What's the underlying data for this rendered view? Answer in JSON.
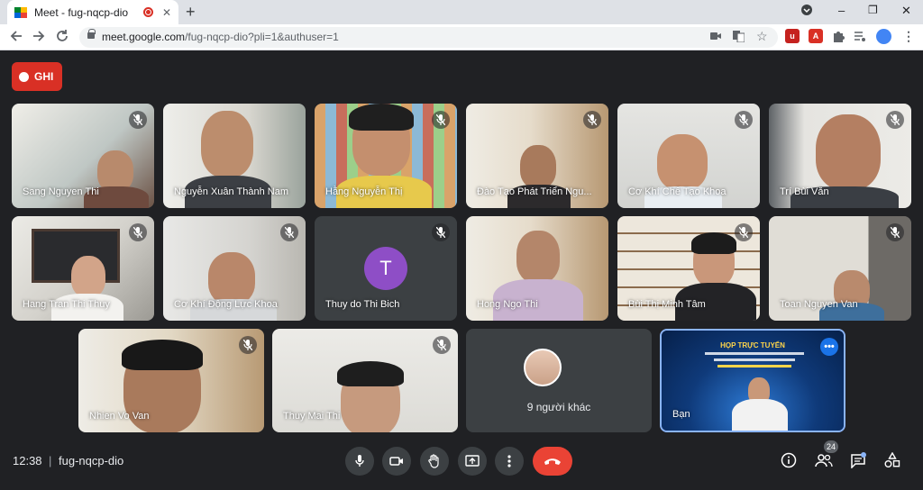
{
  "browser": {
    "tab_title": "Meet - fug-nqcp-dio",
    "tab_close": "✕",
    "new_tab": "+",
    "url_host": "meet.google.com",
    "url_path": "/fug-nqcp-dio?pli=1&authuser=1",
    "window_controls": {
      "minimize": "–",
      "maximize": "❐",
      "close": "✕"
    }
  },
  "meet": {
    "record_label": "GHI",
    "time": "12:38",
    "separator": "|",
    "meeting_code": "fug-nqcp-dio",
    "participants_count": "24",
    "others_label": "9 người khác",
    "self_name": "Bạn",
    "presentation_title": "HỌP TRỰC TUYẾN",
    "participants": [
      "Sang Nguyen Thi",
      "Nguyễn Xuân Thành Nam",
      "Hằng Nguyễn Thị",
      "Đào Tạo Phát Triển Ngu...",
      "Cơ Khí Chế Tạo Khoa",
      "Trí Bùi Văn",
      "Hang Tran Thi Thuy",
      "Cơ Khí Động Lực Khoa",
      "Thuy do Thi Bich",
      "Hong Ngo Thi",
      "Bùi Thị Minh Tâm",
      "Toan Nguyen Van",
      "Nhien Vo Van",
      "Thuy Mai Thi"
    ],
    "avatar_initial": "T"
  },
  "colors": {
    "meet_background": "#202124",
    "record_red": "#d93025",
    "hangup_red": "#ea4335",
    "self_border": "#8ab4f8",
    "avatar_purple": "#8e4ec6"
  },
  "icons": {
    "mute": "mic-off-icon",
    "mic": "mic-icon",
    "camera": "camera-icon",
    "hand": "raise-hand-icon",
    "present": "present-screen-icon",
    "more": "more-vert-icon",
    "hangup": "call-end-icon",
    "info": "info-icon",
    "people": "people-icon",
    "chat": "chat-icon",
    "activities": "activities-icon"
  }
}
